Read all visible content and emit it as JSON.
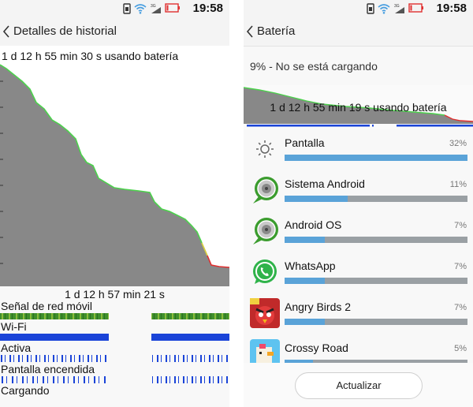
{
  "status_bar": {
    "time": "19:58",
    "signal_label": "3G",
    "icons": [
      "sim-icon",
      "wifi-icon",
      "signal-icon",
      "battery-low-icon"
    ]
  },
  "colors": {
    "chart_fill": "#888888",
    "line_green": "#4cd24c",
    "line_red": "#e03030",
    "wifi_blue": "#1a44d8",
    "usage_bar": "#5aa3d8",
    "usage_track": "#9aa0a4"
  },
  "history_screen": {
    "title": "Detalles de historial",
    "usage_label": "1 d 12 h 55 min 30 s usando batería",
    "time_label": "1 d 12 h 57 min 21 s",
    "signals": [
      {
        "label": "Señal de red móvil"
      },
      {
        "label": "Wi-Fi"
      },
      {
        "label": "Activa"
      },
      {
        "label": "Pantalla encendida"
      },
      {
        "label": "Cargando"
      }
    ]
  },
  "battery_screen": {
    "title": "Batería",
    "status": "9% - No se está cargando",
    "usage_label": "1 d 12 h 55 min 19 s usando batería",
    "apps": [
      {
        "name": "Pantalla",
        "percent": "32%",
        "value": 32,
        "icon": "brightness-icon"
      },
      {
        "name": "Sistema Android",
        "percent": "11%",
        "value": 11,
        "icon": "android-system-icon"
      },
      {
        "name": "Android OS",
        "percent": "7%",
        "value": 7,
        "icon": "android-os-icon"
      },
      {
        "name": "WhatsApp",
        "percent": "7%",
        "value": 7,
        "icon": "whatsapp-icon"
      },
      {
        "name": "Angry Birds 2",
        "percent": "7%",
        "value": 7,
        "icon": "angry-birds-icon"
      },
      {
        "name": "Crossy Road",
        "percent": "5%",
        "value": 5,
        "icon": "crossy-road-icon"
      }
    ],
    "refresh_label": "Actualizar"
  }
}
